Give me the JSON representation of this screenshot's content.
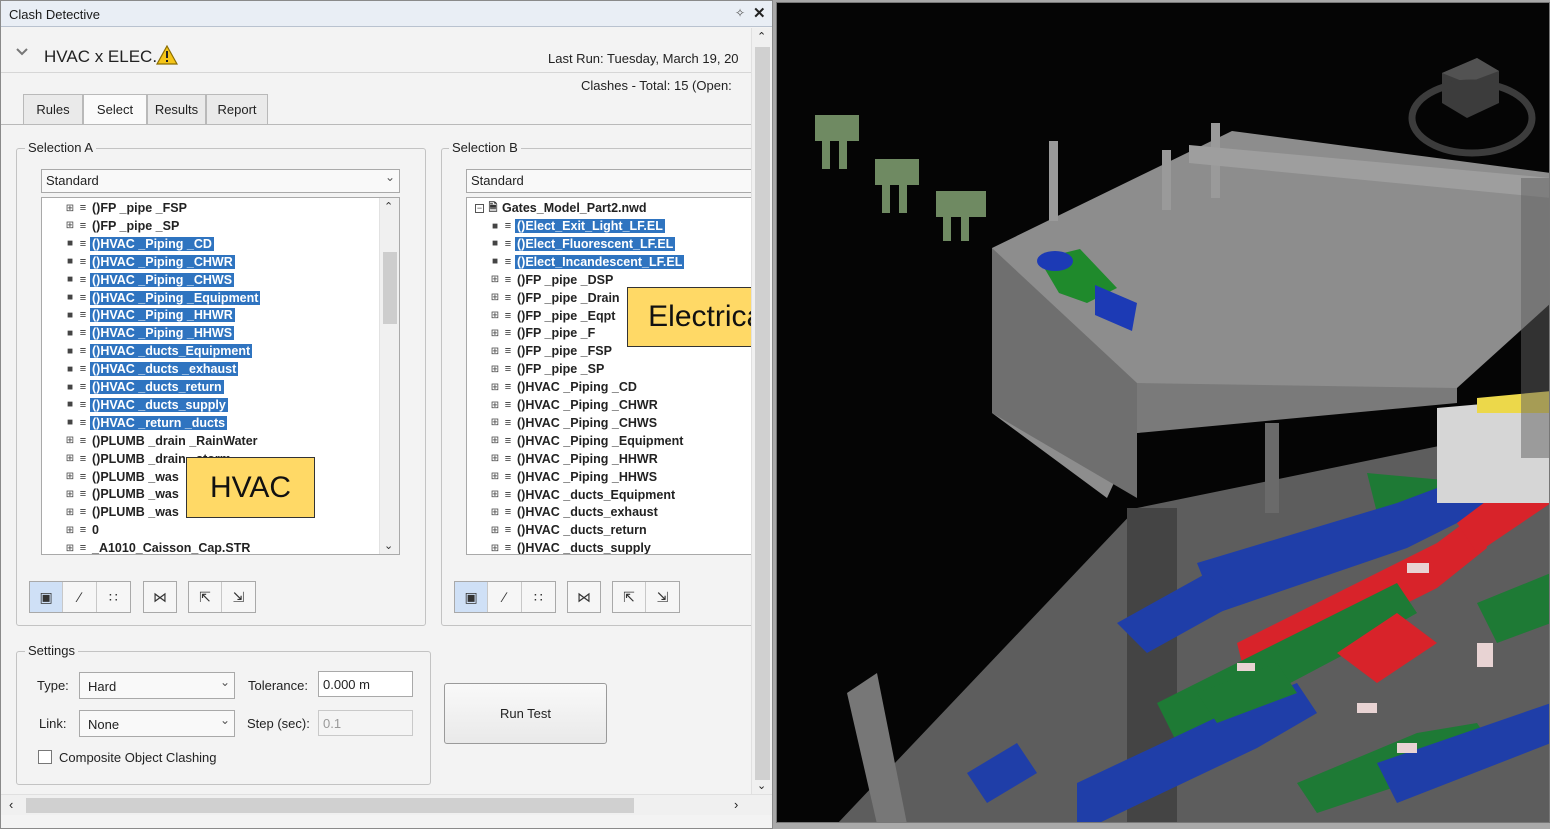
{
  "window": {
    "title": "Clash Detective"
  },
  "test": {
    "name": "HVAC x ELEC.",
    "last_run": "Last Run:  Tuesday, March 19, 20",
    "clashes": "Clashes -   Total:  15  (Open:"
  },
  "tabs": [
    {
      "label": "Rules",
      "active": false
    },
    {
      "label": "Select",
      "active": true
    },
    {
      "label": "Results",
      "active": false
    },
    {
      "label": "Report",
      "active": false
    }
  ],
  "selection_a": {
    "title": "Selection A",
    "mode": "Standard",
    "items": [
      {
        "label": "()FP _pipe _FSP",
        "selected": false
      },
      {
        "label": "()FP _pipe _SP",
        "selected": false
      },
      {
        "label": "()HVAC _Piping _CD",
        "selected": true
      },
      {
        "label": "()HVAC _Piping _CHWR",
        "selected": true
      },
      {
        "label": "()HVAC _Piping _CHWS",
        "selected": true
      },
      {
        "label": "()HVAC _Piping _Equipment",
        "selected": true
      },
      {
        "label": "()HVAC _Piping _HHWR",
        "selected": true
      },
      {
        "label": "()HVAC _Piping _HHWS",
        "selected": true
      },
      {
        "label": "()HVAC _ducts_Equipment",
        "selected": true
      },
      {
        "label": "()HVAC _ducts _exhaust",
        "selected": true
      },
      {
        "label": "()HVAC _ducts_return",
        "selected": true
      },
      {
        "label": "()HVAC _ducts_supply",
        "selected": true
      },
      {
        "label": "()HVAC _return _ducts",
        "selected": true
      },
      {
        "label": "()PLUMB _drain _RainWater",
        "selected": false
      },
      {
        "label": "()PLUMB _drain _storm",
        "selected": false
      },
      {
        "label": "()PLUMB _was",
        "selected": false
      },
      {
        "label": "()PLUMB _was",
        "selected": false
      },
      {
        "label": "()PLUMB _was",
        "selected": false
      },
      {
        "label": "0",
        "selected": false
      },
      {
        "label": "_A1010_Caisson_Cap.STR",
        "selected": false
      }
    ]
  },
  "selection_b": {
    "title": "Selection B",
    "mode": "Standard",
    "root": "Gates_Model_Part2.nwd",
    "items": [
      {
        "label": "()Elect_Exit_Light_LF.EL",
        "selected": true
      },
      {
        "label": "()Elect_Fluorescent_LF.EL",
        "selected": true
      },
      {
        "label": "()Elect_Incandescent_LF.EL",
        "selected": true
      },
      {
        "label": "()FP _pipe _DSP",
        "selected": false
      },
      {
        "label": "()FP _pipe _Drain",
        "selected": false
      },
      {
        "label": "()FP _pipe _Eqpt",
        "selected": false
      },
      {
        "label": "()FP _pipe _F",
        "selected": false
      },
      {
        "label": "()FP _pipe _FSP",
        "selected": false
      },
      {
        "label": "()FP _pipe _SP",
        "selected": false
      },
      {
        "label": "()HVAC _Piping _CD",
        "selected": false
      },
      {
        "label": "()HVAC _Piping _CHWR",
        "selected": false
      },
      {
        "label": "()HVAC _Piping _CHWS",
        "selected": false
      },
      {
        "label": "()HVAC _Piping _Equipment",
        "selected": false
      },
      {
        "label": "()HVAC _Piping _HHWR",
        "selected": false
      },
      {
        "label": "()HVAC _Piping _HHWS",
        "selected": false
      },
      {
        "label": "()HVAC _ducts_Equipment",
        "selected": false
      },
      {
        "label": "()HVAC _ducts_exhaust",
        "selected": false
      },
      {
        "label": "()HVAC _ducts_return",
        "selected": false
      },
      {
        "label": "()HVAC _ducts_supply",
        "selected": false
      }
    ]
  },
  "settings": {
    "title": "Settings",
    "type_label": "Type:",
    "type_value": "Hard",
    "tolerance_label": "Tolerance:",
    "tolerance_value": "0.000 m",
    "link_label": "Link:",
    "link_value": "None",
    "step_label": "Step (sec):",
    "step_value": "0.1",
    "composite_label": "Composite Object Clashing",
    "composite_checked": false
  },
  "run_test_label": "Run Test",
  "callouts": {
    "hvac": "HVAC",
    "electrical": "Electrical"
  },
  "icons": {
    "collapse": "chevron-down-icon",
    "warning": "warning-icon",
    "pin": "pin-icon",
    "close": "close-icon",
    "expand": "plus-box-icon",
    "layer": "layer-icon",
    "file": "file-icon"
  },
  "colors": {
    "selection": "#2f74c0",
    "callout": "#ffd966",
    "duct_green": "#1e7a35",
    "duct_blue": "#1f3ea8",
    "duct_red": "#d8232a"
  }
}
